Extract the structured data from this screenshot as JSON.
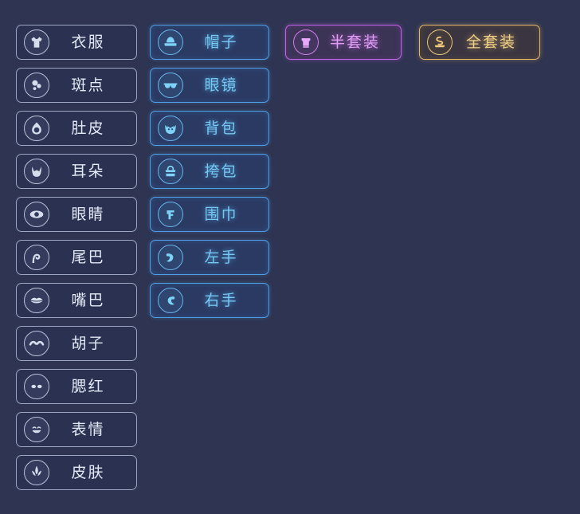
{
  "theme": {
    "background": "#2e3451",
    "default_border": "#9aa6c4",
    "default_text": "#e3e9f6",
    "blue_accent": "#76c7f2",
    "purple_accent": "#e29ef5",
    "gold_accent": "#f0cf86"
  },
  "columns": [
    {
      "name": "body-parts-column",
      "style": "default",
      "items": [
        {
          "label": "衣服",
          "icon": "shirt-icon"
        },
        {
          "label": "斑点",
          "icon": "spots-icon"
        },
        {
          "label": "肚皮",
          "icon": "belly-icon"
        },
        {
          "label": "耳朵",
          "icon": "ears-icon"
        },
        {
          "label": "眼睛",
          "icon": "eye-icon"
        },
        {
          "label": "尾巴",
          "icon": "tail-icon"
        },
        {
          "label": "嘴巴",
          "icon": "mouth-icon"
        },
        {
          "label": "胡子",
          "icon": "whiskers-icon"
        },
        {
          "label": "腮红",
          "icon": "blush-icon"
        },
        {
          "label": "表情",
          "icon": "expression-icon"
        },
        {
          "label": "皮肤",
          "icon": "skin-icon"
        }
      ]
    },
    {
      "name": "accessories-column",
      "style": "blue",
      "items": [
        {
          "label": "帽子",
          "icon": "hat-icon"
        },
        {
          "label": "眼镜",
          "icon": "glasses-icon"
        },
        {
          "label": "背包",
          "icon": "backpack-icon"
        },
        {
          "label": "挎包",
          "icon": "handbag-icon"
        },
        {
          "label": "围巾",
          "icon": "scarf-icon"
        },
        {
          "label": "左手",
          "icon": "left-hand-icon"
        },
        {
          "label": "右手",
          "icon": "right-hand-icon"
        }
      ]
    },
    {
      "name": "half-set-column",
      "style": "purple",
      "items": [
        {
          "label": "半套装",
          "icon": "half-set-icon"
        }
      ]
    },
    {
      "name": "full-set-column",
      "style": "gold",
      "items": [
        {
          "label": "全套装",
          "icon": "full-set-icon"
        }
      ]
    }
  ]
}
